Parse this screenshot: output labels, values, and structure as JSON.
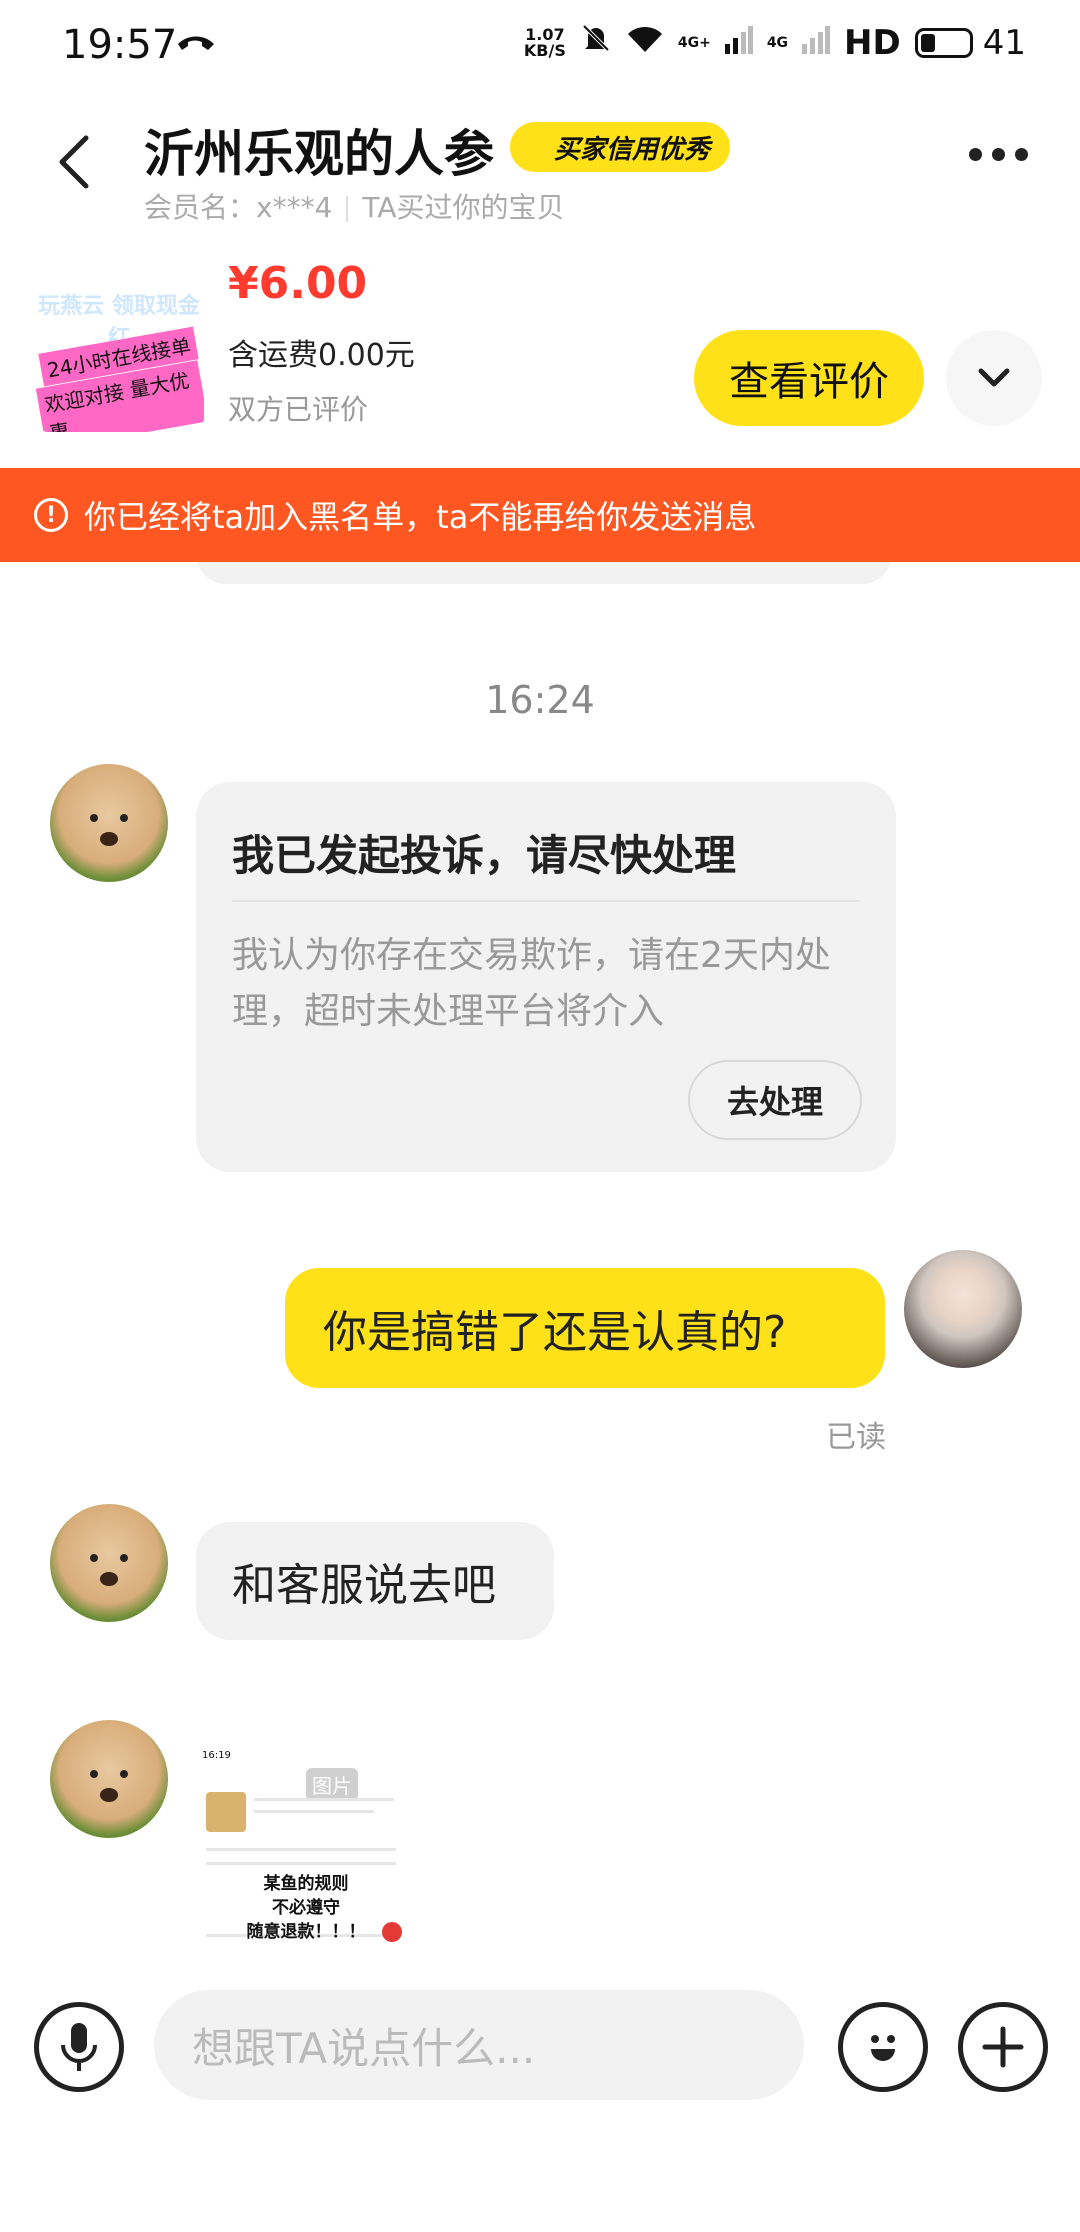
{
  "status_bar": {
    "time": "19:57",
    "speed_value": "1.07",
    "speed_unit": "KB/S",
    "net1": "4G+",
    "net2": "4G",
    "hd": "HD",
    "battery": "41"
  },
  "header": {
    "title": "沂州乐观的人参",
    "badge": "买家信用优秀",
    "member_label": "会员名：x***4",
    "bought_label": "TA买过你的宝贝"
  },
  "product": {
    "image_text_1": "玩燕云 领取现金红",
    "image_text_2": "24小时在线接单",
    "image_text_3": "欢迎对接 量大优惠",
    "price": "¥6.00",
    "shipping": "含运费0.00元",
    "rated_status": "双方已评价",
    "review_button": "查看评价"
  },
  "banner": {
    "text": "你已经将ta加入黑名单，ta不能再给你发送消息"
  },
  "chat": {
    "time_label": "16:24",
    "complaint": {
      "title": "我已发起投诉，请尽快处理",
      "body": "我认为你存在交易欺诈，请在2天内处理，超时未处理平台将介入",
      "button": "去处理"
    },
    "my_message": "你是搞错了还是认真的?",
    "read_status": "已读",
    "other_message": "和客服说去吧",
    "image_message": {
      "tag": "图片",
      "overlay_text": "某鱼的规则\n不必遵守\n随意退款！！！",
      "mini_time": "16:19"
    }
  },
  "input_bar": {
    "placeholder": "想跟TA说点什么..."
  },
  "colors": {
    "accent_yellow": "#ffe11a",
    "warning_orange": "#ff5722",
    "price_red": "#ff3b30"
  }
}
